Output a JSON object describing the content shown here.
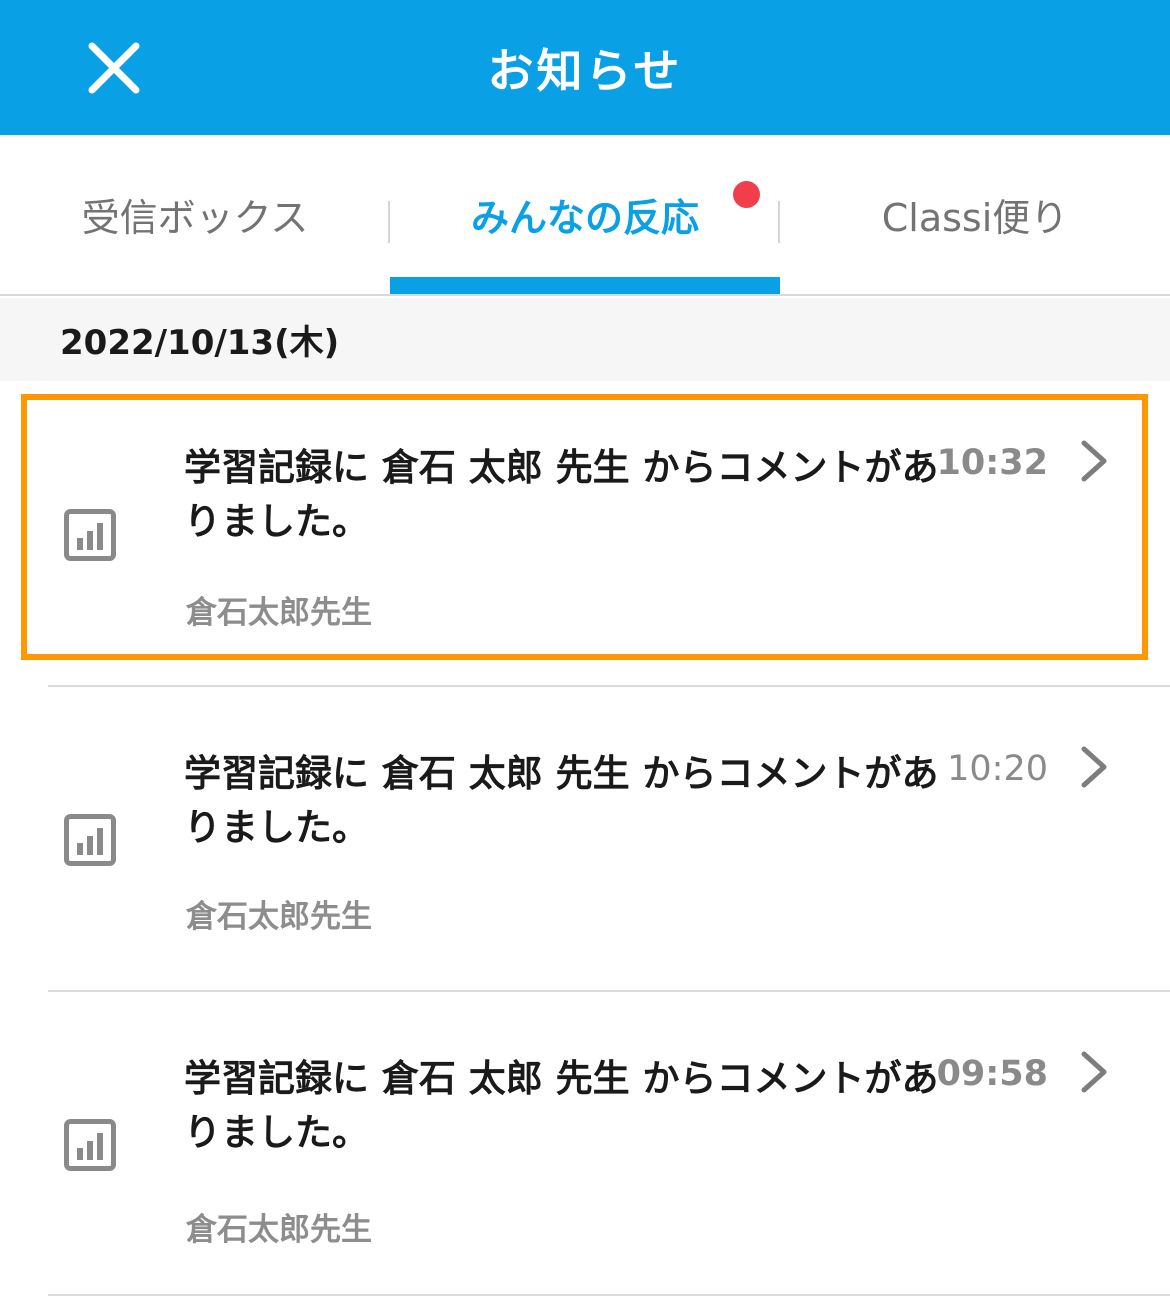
{
  "header": {
    "title": "お知らせ"
  },
  "tabs": [
    {
      "label": "受信ボックス",
      "active": false
    },
    {
      "label": "みんなの反応",
      "active": true,
      "has_badge": true
    },
    {
      "label": "Classi便り",
      "active": false
    }
  ],
  "date_section": {
    "date": "2022/10/13(木)"
  },
  "notifications": [
    {
      "title": "学習記録に 倉石 太郎 先生 からコメントがありました。",
      "time": "10:32",
      "sender": "倉石太郎先生",
      "icon": "bar-chart-icon",
      "highlighted": true
    },
    {
      "title": "学習記録に 倉石 太郎 先生 からコメントがありました。",
      "time": "10:20",
      "sender": "倉石太郎先生",
      "icon": "bar-chart-icon",
      "highlighted": false
    },
    {
      "title": "学習記録に 倉石 太郎 先生 からコメントがありました。",
      "time": "09:58",
      "sender": "倉石太郎先生",
      "icon": "bar-chart-icon",
      "highlighted": false
    }
  ],
  "colors": {
    "brand": "#0aa0e6",
    "badge": "#f23d4b",
    "highlight": "#ff9800"
  }
}
